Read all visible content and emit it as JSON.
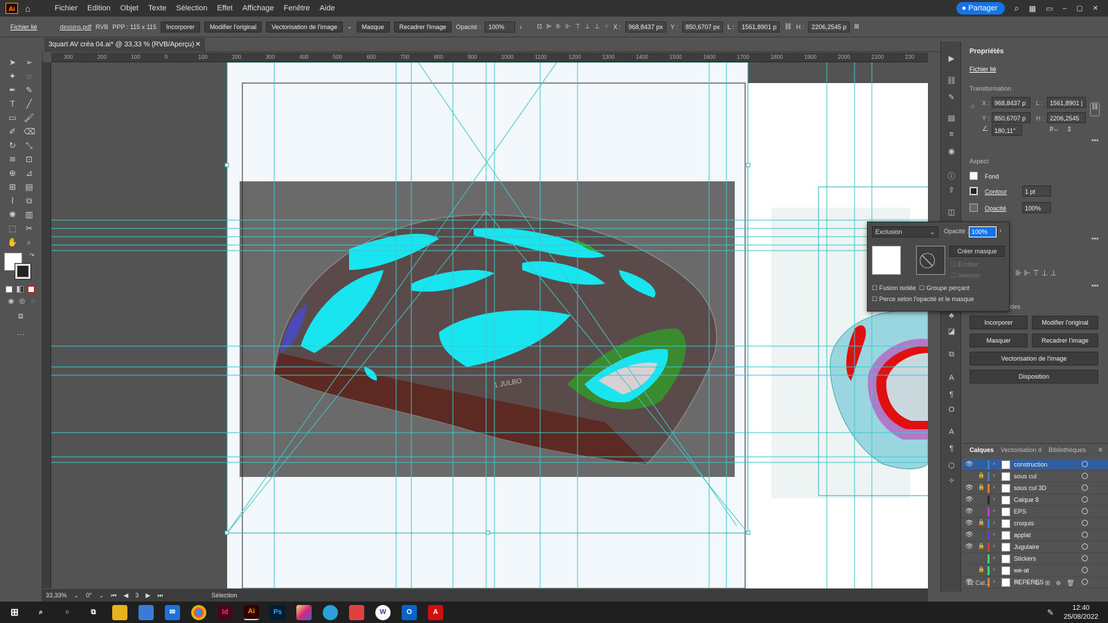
{
  "app": {
    "logo": "Ai",
    "share_label": "Partager"
  },
  "menu": [
    "Fichier",
    "Edition",
    "Objet",
    "Texte",
    "Sélection",
    "Effet",
    "Affichage",
    "Fenêtre",
    "Aide"
  ],
  "control": {
    "linked_file_label": "Fichier lié",
    "filename": "dessins.pdf",
    "color_mode": "RVB",
    "ppp": "PPP : 115 x 115",
    "embed": "Incorporer",
    "edit_original": "Modifier l'original",
    "image_trace": "Vectorisation de l'image",
    "mask": "Masque",
    "crop": "Recadrer l'image",
    "opacity_label": "Opacité :",
    "opacity_value": "100%",
    "x_label": "X :",
    "x_value": "968,8437 px",
    "y_label": "Y :",
    "y_value": "850,6707 px",
    "w_label": "L :",
    "w_value": "1561,8901 p",
    "h_label": "H :",
    "h_value": "2206,2545 p"
  },
  "document": {
    "tab_title": "3quart AV créa 04.ai* @ 33,33 % (RVB/Aperçu)"
  },
  "ruler": {
    "top_ticks": [
      "300",
      "200",
      "100",
      "0",
      "100",
      "200",
      "300",
      "400",
      "500",
      "600",
      "700",
      "800",
      "900",
      "1000",
      "1100",
      "1200",
      "1300",
      "1400",
      "1500",
      "1600",
      "1700",
      "1800",
      "1900",
      "2000",
      "2100",
      "220"
    ]
  },
  "canvas": {
    "helmet_text": "1 JULBO"
  },
  "status": {
    "zoom": "33,33%",
    "rotation": "0°",
    "artboard": "3",
    "mode": "Sélection"
  },
  "properties": {
    "tab": "Propriétés",
    "type": "Fichier lié",
    "transformation": "Transformation",
    "x_label": "X :",
    "x_value": "968,8437 p",
    "y_label": "Y :",
    "y_value": "850,6707 p",
    "w_label": "L :",
    "w_value": "1561,8901 |",
    "h_label": "H :",
    "h_value": "2206,2545 p",
    "angle": "180,11°",
    "aspect": "Aspect",
    "fill": "Fond",
    "stroke": "Contour",
    "stroke_weight": "1 pt",
    "opacity": "Opacité",
    "opacity_value": "100%",
    "quick_actions": "Sélections rapides",
    "btn_embed": "Incorporer",
    "btn_edit": "Modifier l'original",
    "btn_mask": "Masquer",
    "btn_crop": "Recadrer l'image",
    "btn_trace": "Vectorisation de l'image",
    "btn_arrange": "Disposition"
  },
  "transparency": {
    "blend_mode": "Exclusion",
    "opacity_label": "Opacité :",
    "opacity_value": "100%",
    "make_mask": "Créer masque",
    "clip": "Écrêter",
    "invert": "Inverser",
    "isolate": "Fusion isolée",
    "knockout": "Groupe perçant",
    "shape": "Perce selon l'opacité et le masque"
  },
  "layers_panel": {
    "tabs": [
      "Calques",
      "Vectorisation d",
      "Bibliothèques"
    ],
    "layers": [
      {
        "name": "construction",
        "color": "#3b7bd6",
        "visible": true,
        "locked": false
      },
      {
        "name": "sous cul",
        "color": "#3b7bd6",
        "visible": false,
        "locked": true
      },
      {
        "name": "sous cul 3D",
        "color": "#e07a2b",
        "visible": true,
        "locked": true
      },
      {
        "name": "Calque 8",
        "color": "#2b2b2b",
        "visible": true,
        "locked": false
      },
      {
        "name": "EPS",
        "color": "#c23bd6",
        "visible": true,
        "locked": false
      },
      {
        "name": "croquis",
        "color": "#3b7bd6",
        "visible": true,
        "locked": true
      },
      {
        "name": "applat",
        "color": "#6a3bd6",
        "visible": true,
        "locked": false
      },
      {
        "name": "Jugulaire",
        "color": "#d63b3b",
        "visible": true,
        "locked": true
      },
      {
        "name": "Stickers",
        "color": "#3bd66a",
        "visible": false,
        "locked": false
      },
      {
        "name": "we-at",
        "color": "#3bd66a",
        "visible": false,
        "locked": true
      },
      {
        "name": "REPERES",
        "color": "#e07a2b",
        "visible": true,
        "locked": false
      }
    ],
    "count": "12 Cal..."
  },
  "taskbar": {
    "time": "12:40",
    "date": "25/08/2022"
  }
}
